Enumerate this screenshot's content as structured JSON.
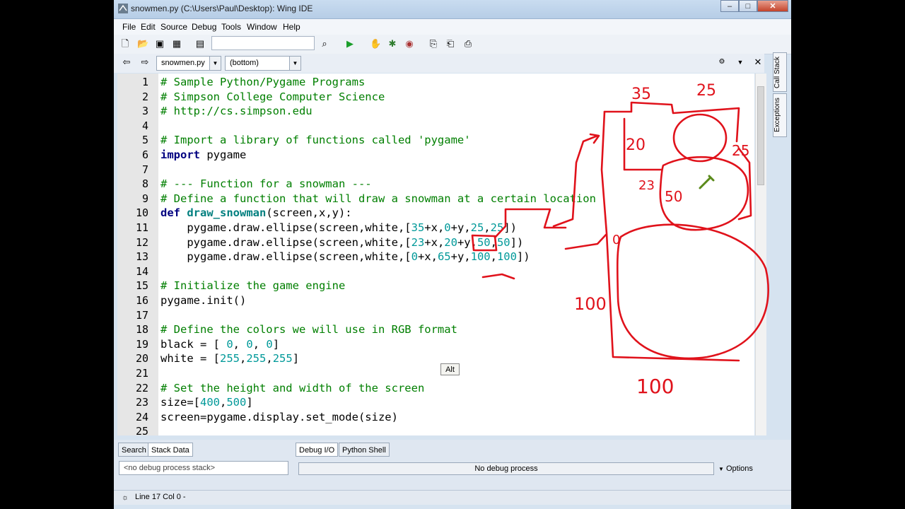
{
  "window": {
    "title": "snowmen.py (C:\\Users\\Paul\\Desktop): Wing IDE"
  },
  "menu": [
    "File",
    "Edit",
    "Source",
    "Debug",
    "Tools",
    "Window",
    "Help"
  ],
  "toolbar": {
    "search_value": ""
  },
  "editor": {
    "file_combo": "snowmen.py",
    "scope_combo": "(bottom)",
    "lines": [
      {
        "n": "1",
        "html": "<span class=\"cm\"># Sample Python/Pygame Programs</span>"
      },
      {
        "n": "2",
        "html": "<span class=\"cm\"># Simpson College Computer Science</span>"
      },
      {
        "n": "3",
        "html": "<span class=\"cm\"># http://cs.simpson.edu</span>"
      },
      {
        "n": "4",
        "html": ""
      },
      {
        "n": "5",
        "html": "<span class=\"cm\"># Import a library of functions called 'pygame'</span>"
      },
      {
        "n": "6",
        "html": "<span class=\"kw\">import</span> pygame"
      },
      {
        "n": "7",
        "html": ""
      },
      {
        "n": "8",
        "html": "<span class=\"cm\"># --- Function for a snowman ---</span>"
      },
      {
        "n": "9",
        "html": "<span class=\"cm\"># Define a function that will draw a snowman at a certain location</span>"
      },
      {
        "n": "10",
        "html": "<span class=\"kw\">def</span> <span class=\"fn\">draw_snowman</span>(screen,x,y):"
      },
      {
        "n": "11",
        "html": "    pygame.draw.ellipse(screen,white,[<span class=\"num\">35</span>+x,<span class=\"num\">0</span>+y,<span class=\"num\">25</span>,<span class=\"num\">25</span>])"
      },
      {
        "n": "12",
        "html": "    pygame.draw.ellipse(screen,white,[<span class=\"num\">23</span>+x,<span class=\"num\">20</span>+y,<span class=\"num\">50</span>,<span class=\"num\">50</span>])"
      },
      {
        "n": "13",
        "html": "    pygame.draw.ellipse(screen,white,[<span class=\"num\">0</span>+x,<span class=\"num\">65</span>+y,<span class=\"num\">100</span>,<span class=\"num\">100</span>])"
      },
      {
        "n": "14",
        "html": ""
      },
      {
        "n": "15",
        "html": "<span class=\"cm\"># Initialize the game engine</span>"
      },
      {
        "n": "16",
        "html": "pygame.init()"
      },
      {
        "n": "17",
        "html": ""
      },
      {
        "n": "18",
        "html": "<span class=\"cm\"># Define the colors we will use in RGB format</span>"
      },
      {
        "n": "19",
        "html": "black = [ <span class=\"num\">0</span>, <span class=\"num\">0</span>, <span class=\"num\">0</span>]"
      },
      {
        "n": "20",
        "html": "white = [<span class=\"num\">255</span>,<span class=\"num\">255</span>,<span class=\"num\">255</span>]"
      },
      {
        "n": "21",
        "html": ""
      },
      {
        "n": "22",
        "html": "<span class=\"cm\"># Set the height and width of the screen</span>"
      },
      {
        "n": "23",
        "html": "size=[<span class=\"num\">400</span>,<span class=\"num\">500</span>]"
      },
      {
        "n": "24",
        "html": "screen=pygame.display.set_mode(size)"
      },
      {
        "n": "25",
        "html": ""
      }
    ]
  },
  "sidetabs": [
    "Call Stack",
    "Exceptions"
  ],
  "bottom_panel": {
    "left_tabs": [
      "Search",
      "Stack Data"
    ],
    "right_tabs": [
      "Debug I/O",
      "Python Shell"
    ],
    "stack_placeholder": "<no debug process stack>",
    "status": "No debug process",
    "options_label": "Options"
  },
  "statusbar": {
    "text": "Line 17 Col 0 -"
  },
  "tooltip": {
    "text": "Alt"
  },
  "annotations": [
    "35",
    "25",
    "20",
    "25",
    "23",
    "50",
    "0",
    "100",
    "100"
  ],
  "colors": {
    "ink": "#e0121b",
    "comment": "#007f00",
    "keyword": "#000080",
    "number": "#009999"
  }
}
